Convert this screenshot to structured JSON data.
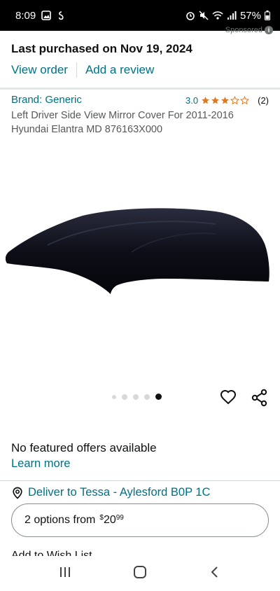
{
  "status_bar": {
    "time": "8:09",
    "battery": "57%",
    "icons": [
      "image-icon",
      "thread-icon",
      "alarm-icon",
      "mute-icon",
      "wifi-icon",
      "signal-icon",
      "battery-icon"
    ]
  },
  "sponsored": {
    "label": "Sponsored"
  },
  "purchase": {
    "title": "Last purchased on Nov 19, 2024",
    "view_order": "View order",
    "add_review": "Add a review"
  },
  "product": {
    "brand": "Brand: Generic",
    "rating_value": "3.0",
    "rating_stars": 3,
    "rating_count": "(2)",
    "title": "Left Driver Side View Mirror Cover For 2011-2016 Hyundai Elantra MD 876163X000",
    "image_count": 5,
    "active_image_index": 4
  },
  "offers": {
    "no_featured": "No featured offers available",
    "learn_more": "Learn more"
  },
  "delivery": {
    "deliver_to": "Deliver to Tessa - Aylesford B0P 1C"
  },
  "options": {
    "label": "2 options from",
    "price_symbol": "$",
    "price_whole": "20",
    "price_fraction": "99"
  },
  "wishlist": {
    "label": "Add to Wish List"
  },
  "colors": {
    "link": "#007185",
    "star": "#de7921",
    "text": "#0f1111",
    "secondary_text": "#565959"
  },
  "nav": {
    "icons": [
      "recent-apps-icon",
      "home-icon",
      "back-icon"
    ]
  }
}
